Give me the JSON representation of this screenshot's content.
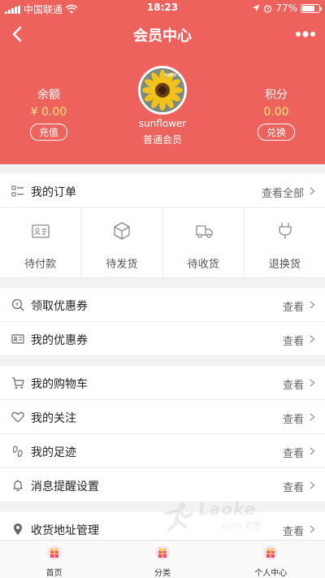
{
  "status_bar": {
    "carrier": "中国联通",
    "time": "18:23",
    "battery": "77%",
    "battery_level": 0.77
  },
  "nav": {
    "title": "会员中心",
    "back_icon": "chevron-left-icon",
    "more_icon": "more-dots-icon"
  },
  "profile": {
    "balance_label": "余额",
    "balance_value": "¥ 0.00",
    "recharge_button": "充值",
    "username": "sunflower",
    "level": "普通会员",
    "points_label": "积分",
    "points_value": "0.00",
    "exchange_button": "兑换"
  },
  "orders": {
    "title": "我的订单",
    "view_all": "查看全部",
    "items": [
      {
        "label": "待付款",
        "icon": "card-icon"
      },
      {
        "label": "待发货",
        "icon": "box-icon"
      },
      {
        "label": "待收货",
        "icon": "truck-icon"
      },
      {
        "label": "退换货",
        "icon": "plug-icon"
      }
    ]
  },
  "menu": {
    "view_label": "查看",
    "items": [
      {
        "label": "领取优惠券",
        "icon": "coupon-icon"
      },
      {
        "label": "我的优惠券",
        "icon": "id-card-icon"
      },
      {
        "label": "我的购物车",
        "icon": "cart-icon"
      },
      {
        "label": "我的关注",
        "icon": "heart-icon"
      },
      {
        "label": "我的足迹",
        "icon": "footprint-icon"
      },
      {
        "label": "消息提醒设置",
        "icon": "bell-icon"
      },
      {
        "label": "收货地址管理",
        "icon": "location-pin-icon"
      }
    ]
  },
  "watermark": {
    "text": "Laoke",
    "sub": ".com 老客"
  },
  "tabbar": {
    "items": [
      {
        "label": "首页",
        "icon": "home-gift-icon"
      },
      {
        "label": "分类",
        "icon": "category-gift-icon"
      },
      {
        "label": "个人中心",
        "icon": "profile-gift-icon"
      }
    ]
  },
  "colors": {
    "primary": "#ed625d",
    "accent_value": "#ffe77a"
  }
}
